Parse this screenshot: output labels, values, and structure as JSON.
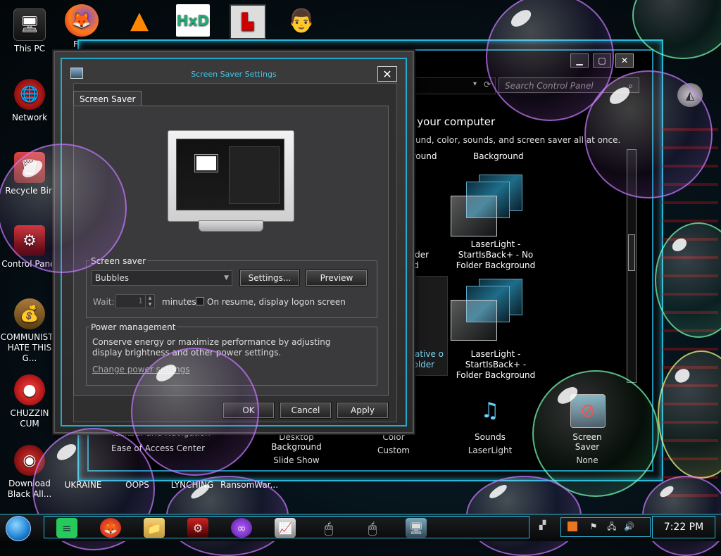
{
  "desktop": {
    "icons_left": [
      {
        "label": "This PC"
      },
      {
        "label": "Network"
      },
      {
        "label": "Recycle Bin"
      },
      {
        "label": "Control Panel"
      },
      {
        "label": "COMMUNISTS HATE THIS G..."
      },
      {
        "label": "CHUZZIN CUM"
      },
      {
        "label": "Download Black All..."
      }
    ],
    "icons_top": [
      {
        "label": "FUR"
      }
    ],
    "icons_bottom": [
      {
        "label": "UKRAINE"
      },
      {
        "label": "OOPS"
      },
      {
        "label": "LYNCHING"
      },
      {
        "label": "RansomWar..."
      }
    ]
  },
  "control_panel": {
    "search_placeholder": "Search Control Panel",
    "heading": "n your computer",
    "subheading": "round, color, sounds, and screen saver all at once.",
    "themes": [
      {
        "label": "ground"
      },
      {
        "label": "Background"
      },
      {
        "label": "D - Folder und"
      },
      {
        "label": "LaserLight - StartIsBack+ - No Folder Background"
      },
      {
        "label": "Native o Folder"
      },
      {
        "label": "LaserLight - StartIsBack+ - Folder Background"
      }
    ],
    "bottom_items": [
      {
        "title": "Desktop Background",
        "value": "Slide Show"
      },
      {
        "title": "Color",
        "value": "Custom"
      },
      {
        "title": "Sounds",
        "value": "LaserLight"
      },
      {
        "title": "Screen Saver",
        "value": "None"
      }
    ],
    "side_links": [
      "Taskbar and Navigation",
      "Ease of Access Center"
    ]
  },
  "dialog": {
    "title": "Screen Saver Settings",
    "tab": "Screen Saver",
    "screensaver_group": "Screen saver",
    "screensaver_selected": "Bubbles",
    "settings_button": "Settings...",
    "preview_button": "Preview",
    "wait_label": "Wait:",
    "wait_value": "1",
    "minutes_label": "minutes",
    "resume_label": "On resume, display logon screen",
    "resume_checked": false,
    "power_group": "Power management",
    "power_text": "Conserve energy or maximize performance by adjusting display brightness and other power settings.",
    "power_link": "Change power settings",
    "ok_button": "OK",
    "cancel_button": "Cancel",
    "apply_button": "Apply"
  },
  "taskbar": {
    "clock": "7:22 PM"
  },
  "colors": {
    "accent": "#2bb8d8",
    "dialog_title": "#3fc7ec"
  }
}
